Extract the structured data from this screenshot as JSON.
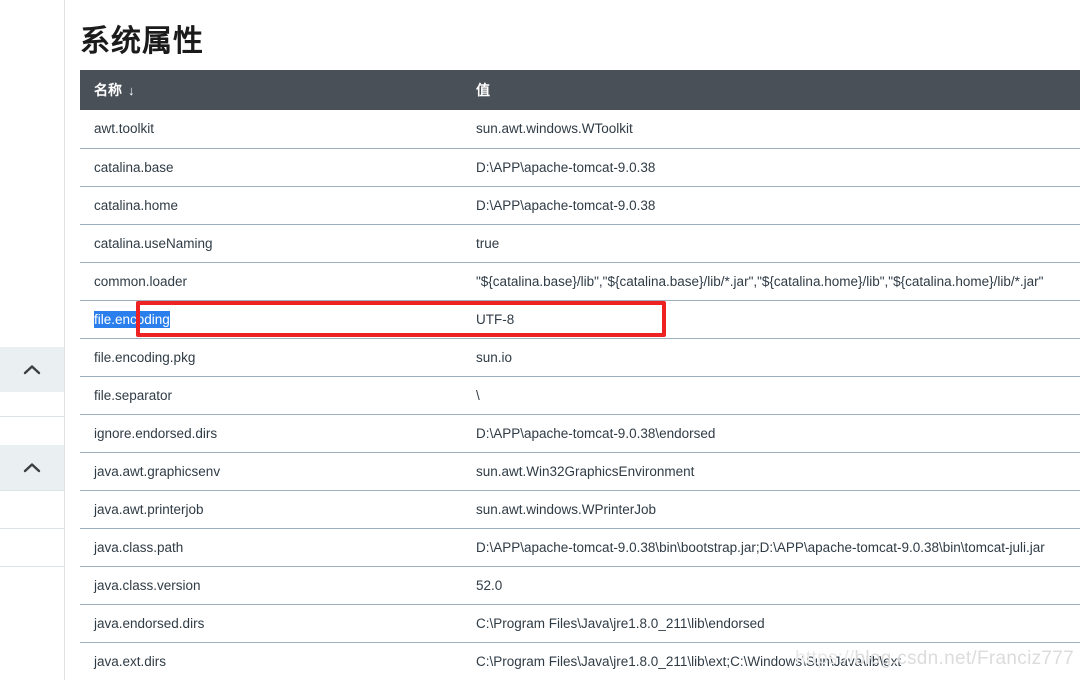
{
  "page": {
    "title": "系统属性",
    "watermark_prefix": "https://",
    "watermark": "blog.csdn.net/Franciz777",
    "accent_header_color": "#4a5058",
    "selection_color": "#2a7fec",
    "annotation_color": "#ee2222"
  },
  "sidebar": {
    "toggles": [
      {
        "icon": "chevron-up-icon",
        "label": ""
      },
      {
        "icon": "chevron-up-icon",
        "label": ""
      }
    ]
  },
  "table": {
    "columns": [
      {
        "key": "name",
        "label": "名称",
        "sort_indicator": "↓"
      },
      {
        "key": "value",
        "label": "值",
        "sort_indicator": ""
      }
    ],
    "rows": [
      {
        "name": "awt.toolkit",
        "value": "sun.awt.windows.WToolkit",
        "selected": false
      },
      {
        "name": "catalina.base",
        "value": "D:\\APP\\apache-tomcat-9.0.38",
        "selected": false
      },
      {
        "name": "catalina.home",
        "value": "D:\\APP\\apache-tomcat-9.0.38",
        "selected": false
      },
      {
        "name": "catalina.useNaming",
        "value": "true",
        "selected": false
      },
      {
        "name": "common.loader",
        "value": "\"${catalina.base}/lib\",\"${catalina.base}/lib/*.jar\",\"${catalina.home}/lib\",\"${catalina.home}/lib/*.jar\"",
        "selected": false
      },
      {
        "name": "file.encoding",
        "value": "UTF-8",
        "selected": true
      },
      {
        "name": "file.encoding.pkg",
        "value": "sun.io",
        "selected": false
      },
      {
        "name": "file.separator",
        "value": "\\",
        "selected": false
      },
      {
        "name": "ignore.endorsed.dirs",
        "value": "D:\\APP\\apache-tomcat-9.0.38\\endorsed",
        "selected": false
      },
      {
        "name": "java.awt.graphicsenv",
        "value": "sun.awt.Win32GraphicsEnvironment",
        "selected": false
      },
      {
        "name": "java.awt.printerjob",
        "value": "sun.awt.windows.WPrinterJob",
        "selected": false
      },
      {
        "name": "java.class.path",
        "value": "D:\\APP\\apache-tomcat-9.0.38\\bin\\bootstrap.jar;D:\\APP\\apache-tomcat-9.0.38\\bin\\tomcat-juli.jar",
        "selected": false
      },
      {
        "name": "java.class.version",
        "value": "52.0",
        "selected": false
      },
      {
        "name": "java.endorsed.dirs",
        "value": "C:\\Program Files\\Java\\jre1.8.0_211\\lib\\endorsed",
        "selected": false
      },
      {
        "name": "java.ext.dirs",
        "value": "C:\\Program Files\\Java\\jre1.8.0_211\\lib\\ext;C:\\Windows\\Sun\\Java\\lib\\ext",
        "selected": false
      }
    ]
  }
}
